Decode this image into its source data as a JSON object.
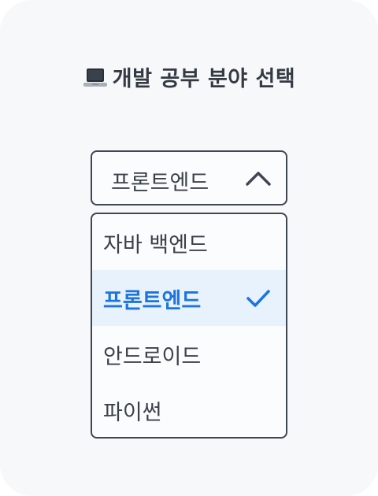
{
  "header": {
    "icon": "laptop-icon",
    "title": "개발 공부 분야 선택"
  },
  "select": {
    "current_value": "프론트엔드",
    "chevron_icon": "chevron-up-icon",
    "expanded": true
  },
  "menu": {
    "options": [
      {
        "label": "자바 백엔드",
        "selected": false
      },
      {
        "label": "프론트엔드",
        "selected": true
      },
      {
        "label": "안드로이드",
        "selected": false
      },
      {
        "label": "파이썬",
        "selected": false
      }
    ],
    "check_icon": "checkmark-icon"
  },
  "colors": {
    "accent": "#1c74dc",
    "selected_bg": "#e7f2fd",
    "border": "#3f4752",
    "text": "#3a4149",
    "card_bg": "#f7f8fa"
  }
}
